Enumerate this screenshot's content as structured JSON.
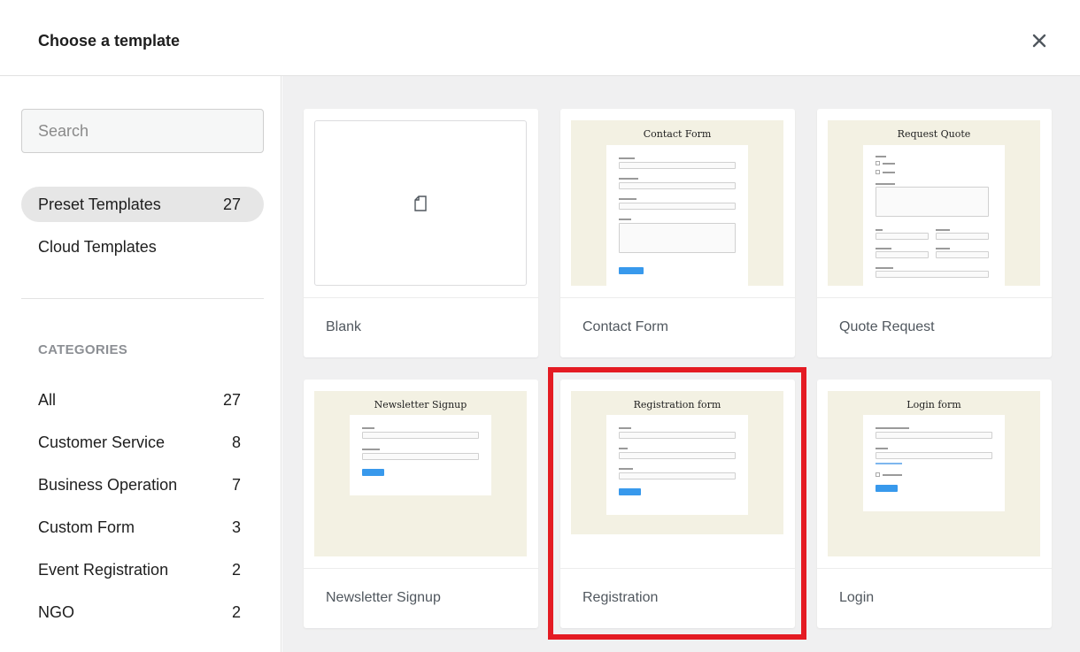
{
  "header": {
    "title": "Choose a template",
    "close_icon": "close-icon"
  },
  "sidebar": {
    "search": {
      "placeholder": "Search",
      "value": ""
    },
    "nav": [
      {
        "label": "Preset Templates",
        "count": "27",
        "active": true
      },
      {
        "label": "Cloud Templates",
        "count": "",
        "active": false
      }
    ],
    "categories_heading": "CATEGORIES",
    "categories": [
      {
        "label": "All",
        "count": "27"
      },
      {
        "label": "Customer Service",
        "count": "8"
      },
      {
        "label": "Business Operation",
        "count": "7"
      },
      {
        "label": "Custom Form",
        "count": "3"
      },
      {
        "label": "Event Registration",
        "count": "2"
      },
      {
        "label": "NGO",
        "count": "2"
      }
    ]
  },
  "templates": [
    {
      "name": "Blank",
      "preview_title": "",
      "icon": "page-icon"
    },
    {
      "name": "Contact Form",
      "preview_title": "Contact Form"
    },
    {
      "name": "Quote Request",
      "preview_title": "Request Quote"
    },
    {
      "name": "Newsletter Signup",
      "preview_title": "Newsletter Signup"
    },
    {
      "name": "Registration",
      "preview_title": "Registration form",
      "highlighted": true
    },
    {
      "name": "Login",
      "preview_title": "Login form"
    }
  ],
  "colors": {
    "preview_bg": "#f3f1e3",
    "button_blue": "#3899ec",
    "highlight_red": "#e41b23"
  }
}
